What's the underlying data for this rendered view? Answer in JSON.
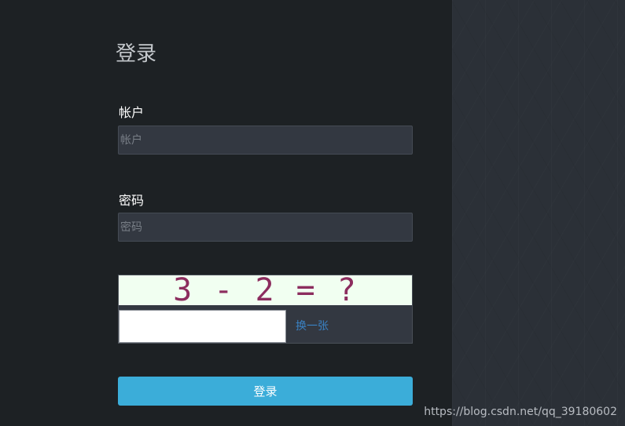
{
  "page": {
    "title": "登录"
  },
  "account": {
    "label": "帐户",
    "placeholder": "帐户",
    "value": ""
  },
  "password": {
    "label": "密码",
    "placeholder": "密码",
    "value": ""
  },
  "captcha": {
    "text": "3 - 2 = ?",
    "input_value": "",
    "refresh_label": "换一张"
  },
  "submit": {
    "label": "登录"
  },
  "watermark": {
    "text": "https://blog.csdn.net/qq_39180602"
  },
  "colors": {
    "left_background": "#1d2124",
    "right_background": "#2b3037",
    "input_background": "#333841",
    "button": "#3badd9",
    "captcha_text": "#8c2d5e",
    "captcha_background": "#f1fff1",
    "link": "#3a82c4"
  }
}
